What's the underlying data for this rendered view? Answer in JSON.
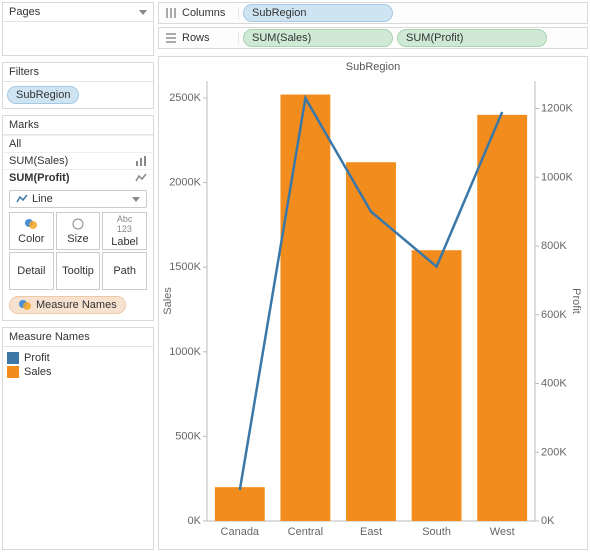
{
  "left": {
    "pages": {
      "title": "Pages"
    },
    "filters": {
      "title": "Filters",
      "pill": "SubRegion"
    },
    "marks": {
      "title": "Marks",
      "rows": [
        {
          "label": "All",
          "icon": ""
        },
        {
          "label": "SUM(Sales)",
          "icon": "bar"
        },
        {
          "label": "SUM(Profit)",
          "icon": "line",
          "bold": true
        }
      ],
      "dropdown": "Line",
      "buttons": [
        "Color",
        "Size",
        "Label",
        "Detail",
        "Tooltip",
        "Path"
      ],
      "measure_names_pill": "Measure Names"
    },
    "legend": {
      "title": "Measure Names",
      "items": [
        {
          "label": "Profit",
          "color": "#3b78a8"
        },
        {
          "label": "Sales",
          "color": "#f28c1c"
        }
      ]
    }
  },
  "shelves": {
    "columns": {
      "label": "Columns",
      "pill": "SubRegion"
    },
    "rows": {
      "label": "Rows",
      "pills": [
        "SUM(Sales)",
        "SUM(Profit)"
      ]
    }
  },
  "chart_title": "SubRegion",
  "chart_data": {
    "type": "bar",
    "categories": [
      "Canada",
      "Central",
      "East",
      "South",
      "West"
    ],
    "series": [
      {
        "name": "Sales",
        "type": "bar",
        "color": "#f28c1c",
        "axis": "left",
        "values": [
          200000,
          2520000,
          2120000,
          1600000,
          2400000
        ]
      },
      {
        "name": "Profit",
        "type": "line",
        "color": "#3b78a8",
        "axis": "right",
        "values": [
          90000,
          1230000,
          900000,
          740000,
          1190000
        ]
      }
    ],
    "ylabel_left": "Sales",
    "ylabel_right": "Profit",
    "ylim_left": [
      0,
      2600000
    ],
    "ylim_right": [
      0,
      1280000
    ],
    "yticks_left": [
      "0K",
      "500K",
      "1000K",
      "1500K",
      "2000K",
      "2500K"
    ],
    "yticks_right": [
      "0K",
      "200K",
      "400K",
      "600K",
      "800K",
      "1000K",
      "1200K"
    ]
  }
}
